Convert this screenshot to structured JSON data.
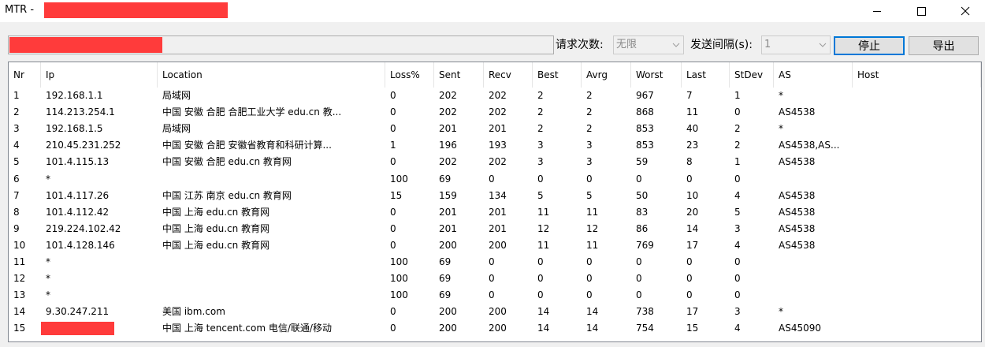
{
  "window": {
    "title": "MTR -",
    "controls": [
      "minimize-icon",
      "maximize-icon",
      "close-icon"
    ]
  },
  "toolbar": {
    "target_value": "",
    "count_label": "请求次数:",
    "count_value": "无限",
    "interval_label": "发送间隔(s):",
    "interval_value": "1",
    "stop_label": "停止",
    "export_label": "导出"
  },
  "chart_data": {
    "type": "table",
    "columns": [
      "Nr",
      "Ip",
      "Location",
      "Loss%",
      "Sent",
      "Recv",
      "Best",
      "Avrg",
      "Worst",
      "Last",
      "StDev",
      "AS",
      "Host"
    ],
    "rows": [
      [
        "1",
        "192.168.1.1",
        "局域网",
        "0",
        "202",
        "202",
        "2",
        "2",
        "967",
        "7",
        "1",
        "*",
        ""
      ],
      [
        "2",
        "114.213.254.1",
        "中国 安徽 合肥 合肥工业大学 edu.cn 教...",
        "0",
        "202",
        "202",
        "2",
        "2",
        "868",
        "11",
        "0",
        "AS4538",
        ""
      ],
      [
        "3",
        "192.168.1.5",
        "局域网",
        "0",
        "201",
        "201",
        "2",
        "2",
        "853",
        "40",
        "2",
        "*",
        ""
      ],
      [
        "4",
        "210.45.231.252",
        "中国 安徽 合肥 安徽省教育和科研计算...",
        "1",
        "196",
        "193",
        "3",
        "3",
        "853",
        "23",
        "2",
        "AS4538,AS...",
        ""
      ],
      [
        "5",
        "101.4.115.13",
        "中国 安徽 合肥 edu.cn 教育网",
        "0",
        "202",
        "202",
        "3",
        "3",
        "59",
        "8",
        "1",
        "AS4538",
        ""
      ],
      [
        "6",
        "*",
        "",
        "100",
        "69",
        "0",
        "0",
        "0",
        "0",
        "0",
        "0",
        "",
        ""
      ],
      [
        "7",
        "101.4.117.26",
        "中国 江苏 南京 edu.cn 教育网",
        "15",
        "159",
        "134",
        "5",
        "5",
        "50",
        "10",
        "4",
        "AS4538",
        ""
      ],
      [
        "8",
        "101.4.112.42",
        "中国 上海 edu.cn 教育网",
        "0",
        "201",
        "201",
        "11",
        "11",
        "83",
        "20",
        "5",
        "AS4538",
        ""
      ],
      [
        "9",
        "219.224.102.42",
        "中国 上海 edu.cn 教育网",
        "0",
        "201",
        "201",
        "12",
        "12",
        "86",
        "14",
        "3",
        "AS4538",
        ""
      ],
      [
        "10",
        "101.4.128.146",
        "中国 上海 edu.cn 教育网",
        "0",
        "200",
        "200",
        "11",
        "11",
        "769",
        "17",
        "4",
        "AS4538",
        ""
      ],
      [
        "11",
        "*",
        "",
        "100",
        "69",
        "0",
        "0",
        "0",
        "0",
        "0",
        "0",
        "",
        ""
      ],
      [
        "12",
        "*",
        "",
        "100",
        "69",
        "0",
        "0",
        "0",
        "0",
        "0",
        "0",
        "",
        ""
      ],
      [
        "13",
        "*",
        "",
        "100",
        "69",
        "0",
        "0",
        "0",
        "0",
        "0",
        "0",
        "",
        ""
      ],
      [
        "14",
        "9.30.247.211",
        "美国 ibm.com",
        "0",
        "200",
        "200",
        "14",
        "14",
        "738",
        "17",
        "3",
        "*",
        ""
      ],
      [
        "15",
        "",
        "中国 上海 tencent.com 电信/联通/移动",
        "0",
        "200",
        "200",
        "14",
        "14",
        "754",
        "15",
        "4",
        "AS45090",
        ""
      ]
    ]
  },
  "redacted_color": "#ff3b3b",
  "accent_color": "#0078d7"
}
